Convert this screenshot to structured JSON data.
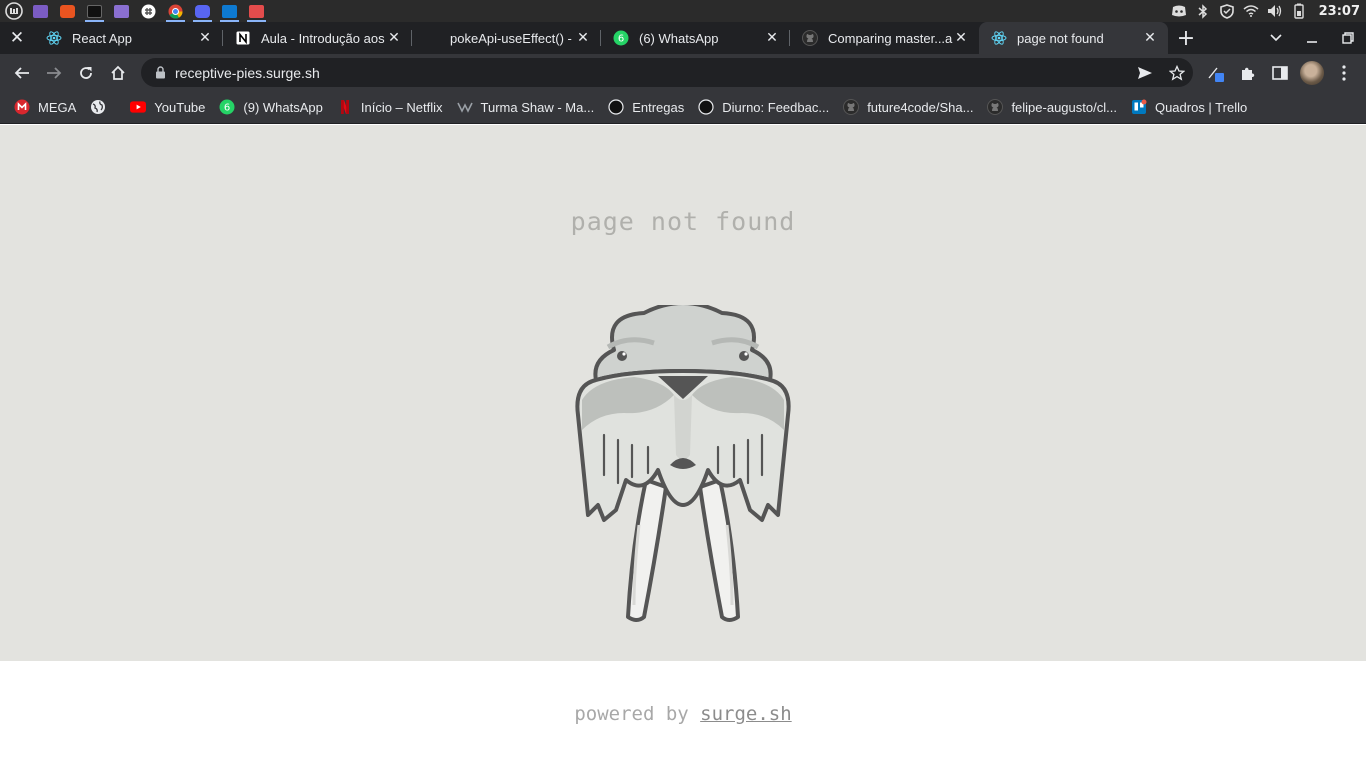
{
  "os_panel": {
    "apps": [
      {
        "icon": "mint-menu-icon",
        "color": "#dddddd"
      },
      {
        "icon": "files-icon",
        "color": "#7b5cc4"
      },
      {
        "icon": "ubuntu-software-icon",
        "color": "#e95420"
      },
      {
        "icon": "terminal-icon",
        "color": "#1e1e1e"
      },
      {
        "icon": "folder-icon",
        "color": "#8a6fd1"
      },
      {
        "icon": "slack-icon",
        "color": "#ffffff"
      },
      {
        "icon": "chrome-icon",
        "color": "#f4b400"
      },
      {
        "icon": "discord-icon",
        "color": "#5865f2"
      },
      {
        "icon": "vscode-icon",
        "color": "#0e7ad1"
      },
      {
        "icon": "gaming-icon",
        "color": "#e34c4c"
      }
    ],
    "clock": "23:07"
  },
  "tabs": [
    {
      "title": "React App",
      "icon": "react-icon",
      "active": false
    },
    {
      "title": "Aula - Introdução aos",
      "icon": "notion-icon",
      "active": false
    },
    {
      "title": "pokeApi-useEffect() -",
      "icon": "blank-icon",
      "active": false
    },
    {
      "title": "(6) WhatsApp",
      "icon": "whatsapp-icon",
      "active": false
    },
    {
      "title": "Comparing master...a",
      "icon": "github-icon",
      "active": false
    },
    {
      "title": "page not found",
      "icon": "react-icon",
      "active": true
    }
  ],
  "toolbar": {
    "url": "receptive-pies.surge.sh"
  },
  "bookmarks": [
    {
      "label": "MEGA",
      "icon": "mega-icon"
    },
    {
      "label": "",
      "icon": "globe-icon"
    },
    {
      "label": "YouTube",
      "icon": "youtube-icon"
    },
    {
      "label": "(9) WhatsApp",
      "icon": "whatsapp-icon"
    },
    {
      "label": "Início – Netflix",
      "icon": "netflix-icon"
    },
    {
      "label": "Turma Shaw - Ma...",
      "icon": "labenu-icon"
    },
    {
      "label": "Entregas",
      "icon": "circle-icon"
    },
    {
      "label": "Diurno: Feedbac...",
      "icon": "circle-icon"
    },
    {
      "label": "future4code/Sha...",
      "icon": "github-icon"
    },
    {
      "label": "felipe-augusto/cl...",
      "icon": "github-icon"
    },
    {
      "label": "Quadros | Trello",
      "icon": "trello-icon"
    }
  ],
  "page": {
    "heading": "page not found",
    "footer_prefix": "powered by ",
    "footer_link": "surge.sh"
  },
  "colors": {
    "page_background": "#e3e3df",
    "heading_color": "#b0b0ac",
    "walrus_outline": "#555555",
    "chrome_dark": "#202124",
    "chrome_toolbar": "#35363a"
  }
}
